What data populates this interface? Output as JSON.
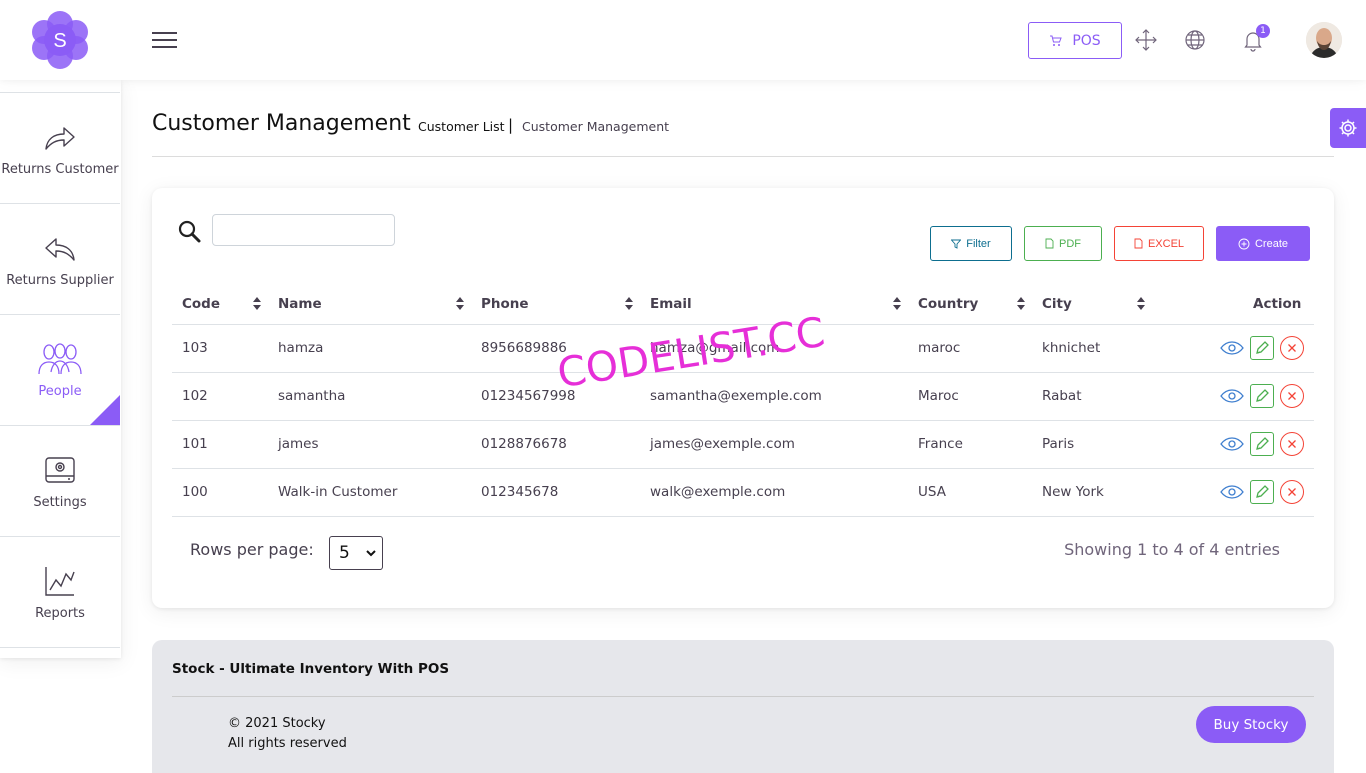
{
  "header": {
    "logo_letter": "S",
    "pos_label": "POS",
    "notification_count": "1",
    "accent_color": "#8b5cf6"
  },
  "sidebar": {
    "items": [
      {
        "label": "Returns Customer",
        "icon": "share-arrow-icon",
        "active": false
      },
      {
        "label": "Returns Supplier",
        "icon": "reply-arrow-icon",
        "active": false
      },
      {
        "label": "People",
        "icon": "people-icon",
        "active": true
      },
      {
        "label": "Settings",
        "icon": "settings-icon",
        "active": false
      },
      {
        "label": "Reports",
        "icon": "chart-icon",
        "active": false
      }
    ]
  },
  "breadcrumb": {
    "title": "Customer Management",
    "current": "Customer List",
    "separator": "|",
    "parent": "Customer Management"
  },
  "toolbar": {
    "search_value": "",
    "filter_label": "Filter",
    "pdf_label": "PDF",
    "excel_label": "EXCEL",
    "create_label": "Create"
  },
  "table": {
    "columns": [
      "Code",
      "Name",
      "Phone",
      "Email",
      "Country",
      "City",
      "Action"
    ],
    "rows": [
      {
        "code": "103",
        "name": "hamza",
        "phone": "8956689886",
        "email": "hamza@gmail.com",
        "country": "maroc",
        "city": "khnichet"
      },
      {
        "code": "102",
        "name": "samantha",
        "phone": "01234567998",
        "email": "samantha@exemple.com",
        "country": "Maroc",
        "city": "Rabat"
      },
      {
        "code": "101",
        "name": "james",
        "phone": "0128876678",
        "email": "james@exemple.com",
        "country": "France",
        "city": "Paris"
      },
      {
        "code": "100",
        "name": "Walk-in Customer",
        "phone": "012345678",
        "email": "walk@exemple.com",
        "country": "USA",
        "city": "New York"
      }
    ]
  },
  "pagination": {
    "rows_per_page_label": "Rows per page:",
    "rows_per_page_value": "5",
    "showing_text": "Showing 1 to 4 of 4 entries"
  },
  "footer": {
    "title": "Stock - Ultimate Inventory With POS",
    "copyright": "© 2021 Stocky",
    "rights": "All rights reserved",
    "buy_label": "Buy Stocky"
  },
  "watermark": "CODELIST.CC"
}
